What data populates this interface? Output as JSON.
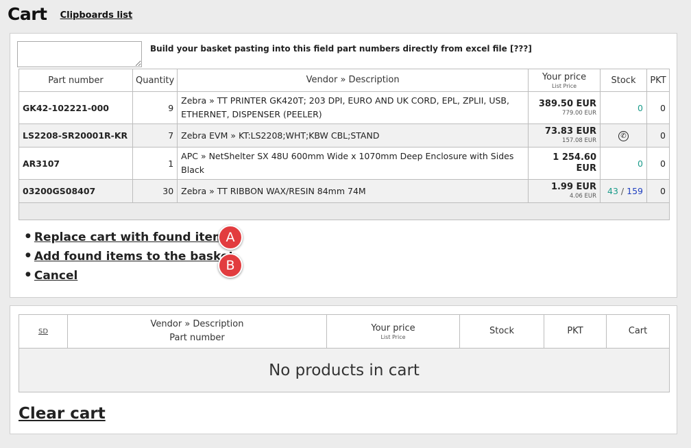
{
  "header": {
    "title": "Cart",
    "clipboards_link": "Clipboards list"
  },
  "import": {
    "paste_value": "",
    "hint": "Build your basket pasting into this field part numbers directly from excel file [???]",
    "columns": {
      "part_number": "Part number",
      "quantity": "Quantity",
      "description": "Vendor » Description",
      "price": "Your price",
      "price_sub": "List Price",
      "stock": "Stock",
      "pkt": "PKT"
    },
    "rows": [
      {
        "part": "GK42-102221-000",
        "qty": "9",
        "desc": "Zebra » TT PRINTER GK420T; 203 DPI, EURO AND UK CORD, EPL, ZPLII, USB, ETHERNET, DISPENSER (PEELER)",
        "price": "389.50 EUR",
        "list_price": "779.00 EUR",
        "stock": "0",
        "pkt": "0"
      },
      {
        "part": "LS2208-SR20001R-KR",
        "qty": "7",
        "desc": "Zebra EVM » KT:LS2208;WHT;KBW CBL;STAND",
        "price": "73.83 EUR",
        "list_price": "157.08 EUR",
        "stock_icon": "phone-icon",
        "pkt": "0"
      },
      {
        "part": "AR3107",
        "qty": "1",
        "desc": "APC » NetShelter SX 48U 600mm Wide x 1070mm Deep Enclosure with Sides Black",
        "price": "1 254.60 EUR",
        "list_price": "",
        "stock": "0",
        "pkt": "0"
      },
      {
        "part": "03200GS08407",
        "qty": "30",
        "desc": "Zebra » TT RIBBON WAX/RESIN 84mm 74M",
        "price": "1.99 EUR",
        "list_price": "4.06 EUR",
        "stock_a": "43",
        "stock_sep": " / ",
        "stock_b": "159",
        "pkt": "0"
      }
    ]
  },
  "actions": {
    "replace": "Replace cart with found items",
    "add": "Add found items to the basket",
    "cancel": "Cancel",
    "marker_a": "A",
    "marker_b": "B"
  },
  "cart": {
    "columns": {
      "sd": "SD",
      "description": "Vendor » Description",
      "part_number": "Part number",
      "price": "Your price",
      "price_sub": "List Price",
      "stock": "Stock",
      "pkt": "PKT",
      "cart": "Cart"
    },
    "empty_message": "No products in cart",
    "clear": "Clear cart"
  },
  "colors": {
    "background": "#ececec",
    "marker": "#e23c3f",
    "stock_green": "#1a9b8a",
    "stock_blue": "#2040c0"
  }
}
